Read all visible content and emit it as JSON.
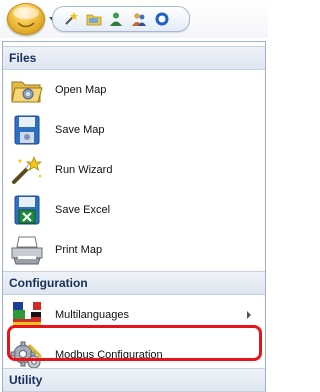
{
  "quick_access": {
    "icons": [
      "app-menu-orb-icon",
      "wand-icon",
      "folder-icon",
      "user-icon",
      "users-icon",
      "blue-circle-icon"
    ]
  },
  "menu": {
    "sections": {
      "files": "Files",
      "configuration": "Configuration",
      "utility": "Utility"
    },
    "items": [
      {
        "label": "Open Map",
        "icon": "open-folder-icon"
      },
      {
        "label": "Save Map",
        "icon": "save-disk-icon"
      },
      {
        "label": "Run Wizard",
        "icon": "magic-wand-icon"
      },
      {
        "label": "Save Excel",
        "icon": "excel-disk-icon"
      },
      {
        "label": "Print Map",
        "icon": "printer-icon"
      },
      {
        "label": "Multilanguages",
        "icon": "flags-icon"
      },
      {
        "label": "Modbus Configuration",
        "icon": "gears-icon"
      }
    ]
  },
  "colors": {
    "highlight": "#e8141c",
    "header_text": "#15305a"
  }
}
